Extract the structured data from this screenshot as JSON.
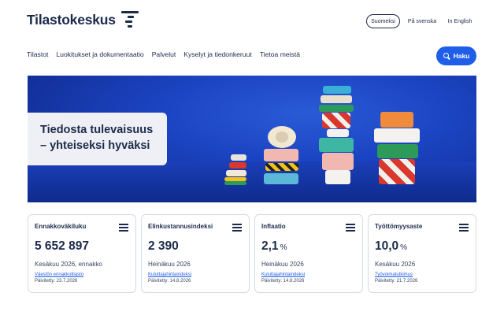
{
  "header": {
    "logo_text": "Tilastokeskus",
    "languages": [
      {
        "label": "Suomeksi",
        "active": true
      },
      {
        "label": "På svenska",
        "active": false
      },
      {
        "label": "In English",
        "active": false
      }
    ],
    "search_label": "Haku",
    "accent_color": "#1f5ee8"
  },
  "nav": {
    "items": [
      "Tilastot",
      "Luokitukset ja dokumentaatio",
      "Palvelut",
      "Kyselyt ja tiedonkeruut",
      "Tietoa meistä"
    ]
  },
  "hero": {
    "title_line1": "Tiedosta tulevaisuus",
    "title_line2": "– yhteiseksi hyväksi"
  },
  "stats": [
    {
      "title": "Ennakkoväkiluku",
      "value": "5 652 897",
      "unit": "",
      "period": "Kesäkuu 2026, ennakko",
      "link": "Väestön ennakkotilasto",
      "updated": "Päivitetty: 23.7.2026"
    },
    {
      "title": "Elinkustannusindeksi",
      "value": "2 390",
      "unit": "",
      "period": "Heinäkuu 2026",
      "link": "Kuluttajahintaindeksi",
      "updated": "Päivitetty: 14.8.2026"
    },
    {
      "title": "Inflaatio",
      "value": "2,1",
      "unit": "%",
      "period": "Heinäkuu 2026",
      "link": "Kuluttajahintaindeksi",
      "updated": "Päivitetty: 14.8.2026"
    },
    {
      "title": "Työttömyysaste",
      "value": "10,0",
      "unit": "%",
      "period": "Kesäkuu 2026",
      "link": "Työvoimatutkimus",
      "updated": "Päivitetty: 21.7.2026"
    }
  ]
}
